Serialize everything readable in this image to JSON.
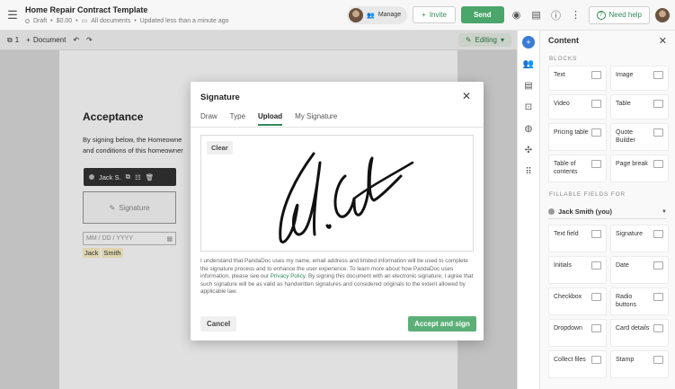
{
  "header": {
    "title": "Home Repair Contract Template",
    "status": "Draft",
    "price": "$0.00",
    "folder": "All documents",
    "updated": "Updated less than a minute ago",
    "manage_label": "Manage",
    "invite_label": "Invite",
    "send_label": "Send",
    "help_label": "Need help"
  },
  "toolbar": {
    "page_count": "1",
    "document_label": "Document",
    "mode_label": "Editing"
  },
  "document": {
    "heading": "Acceptance",
    "para_line1": "By signing below, the Homeowne",
    "para_line2": "and conditions of this homeowner",
    "signer_name": "Jack S.",
    "signature_label": "Signature",
    "date_placeholder": "MM / DD / YYYY",
    "first_name": "Jack",
    "last_name": "Smith"
  },
  "modal": {
    "title": "Signature",
    "tabs": [
      "Draw",
      "Type",
      "Upload",
      "My Signature"
    ],
    "active_tab": "Upload",
    "clear_label": "Clear",
    "legal_before": "I understand that PandaDoc uses my name, email address and limited information will be used to complete the signature process and to enhance the user experience. To learn more about how PandaDoc uses information, please see our ",
    "legal_link": "Privacy Policy",
    "legal_after": ". By signing this document with an electronic signature, I agree that such signature will be as valid as handwritten signatures and considered originals to the extent allowed by applicable law.",
    "cancel_label": "Cancel",
    "accept_label": "Accept and sign"
  },
  "panel": {
    "title": "Content",
    "blocks_title": "BLOCKS",
    "blocks": [
      {
        "label": "Text",
        "icon": "text-icon"
      },
      {
        "label": "Image",
        "icon": "image-icon"
      },
      {
        "label": "Video",
        "icon": "video-icon"
      },
      {
        "label": "Table",
        "icon": "table-icon"
      },
      {
        "label": "Pricing table",
        "icon": "pricing-icon"
      },
      {
        "label": "Quote Builder",
        "icon": "quote-icon"
      },
      {
        "label": "Table of contents",
        "icon": "toc-icon"
      },
      {
        "label": "Page break",
        "icon": "page-break-icon"
      }
    ],
    "fields_title": "FILLABLE FIELDS FOR",
    "signer": "Jack Smith (you)",
    "fields": [
      {
        "label": "Text field",
        "icon": "text-field-icon"
      },
      {
        "label": "Signature",
        "icon": "signature-icon"
      },
      {
        "label": "Initials",
        "icon": "initials-icon"
      },
      {
        "label": "Date",
        "icon": "date-icon"
      },
      {
        "label": "Checkbox",
        "icon": "checkbox-icon"
      },
      {
        "label": "Radio buttons",
        "icon": "radio-icon"
      },
      {
        "label": "Dropdown",
        "icon": "dropdown-icon"
      },
      {
        "label": "Card details",
        "icon": "card-icon"
      },
      {
        "label": "Collect files",
        "icon": "upload-icon"
      },
      {
        "label": "Stamp",
        "icon": "stamp-icon"
      }
    ]
  }
}
